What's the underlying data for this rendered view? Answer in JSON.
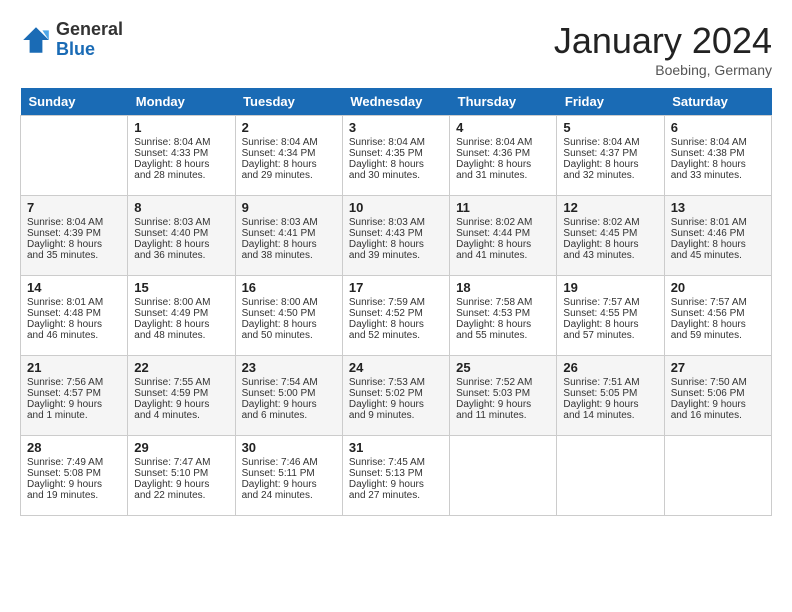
{
  "header": {
    "logo_general": "General",
    "logo_blue": "Blue",
    "month_title": "January 2024",
    "location": "Boebing, Germany"
  },
  "days_of_week": [
    "Sunday",
    "Monday",
    "Tuesday",
    "Wednesday",
    "Thursday",
    "Friday",
    "Saturday"
  ],
  "weeks": [
    [
      {
        "day": "",
        "empty": true
      },
      {
        "day": "1",
        "sunrise": "Sunrise: 8:04 AM",
        "sunset": "Sunset: 4:33 PM",
        "daylight": "Daylight: 8 hours and 28 minutes."
      },
      {
        "day": "2",
        "sunrise": "Sunrise: 8:04 AM",
        "sunset": "Sunset: 4:34 PM",
        "daylight": "Daylight: 8 hours and 29 minutes."
      },
      {
        "day": "3",
        "sunrise": "Sunrise: 8:04 AM",
        "sunset": "Sunset: 4:35 PM",
        "daylight": "Daylight: 8 hours and 30 minutes."
      },
      {
        "day": "4",
        "sunrise": "Sunrise: 8:04 AM",
        "sunset": "Sunset: 4:36 PM",
        "daylight": "Daylight: 8 hours and 31 minutes."
      },
      {
        "day": "5",
        "sunrise": "Sunrise: 8:04 AM",
        "sunset": "Sunset: 4:37 PM",
        "daylight": "Daylight: 8 hours and 32 minutes."
      },
      {
        "day": "6",
        "sunrise": "Sunrise: 8:04 AM",
        "sunset": "Sunset: 4:38 PM",
        "daylight": "Daylight: 8 hours and 33 minutes."
      }
    ],
    [
      {
        "day": "7",
        "sunrise": "Sunrise: 8:04 AM",
        "sunset": "Sunset: 4:39 PM",
        "daylight": "Daylight: 8 hours and 35 minutes."
      },
      {
        "day": "8",
        "sunrise": "Sunrise: 8:03 AM",
        "sunset": "Sunset: 4:40 PM",
        "daylight": "Daylight: 8 hours and 36 minutes."
      },
      {
        "day": "9",
        "sunrise": "Sunrise: 8:03 AM",
        "sunset": "Sunset: 4:41 PM",
        "daylight": "Daylight: 8 hours and 38 minutes."
      },
      {
        "day": "10",
        "sunrise": "Sunrise: 8:03 AM",
        "sunset": "Sunset: 4:43 PM",
        "daylight": "Daylight: 8 hours and 39 minutes."
      },
      {
        "day": "11",
        "sunrise": "Sunrise: 8:02 AM",
        "sunset": "Sunset: 4:44 PM",
        "daylight": "Daylight: 8 hours and 41 minutes."
      },
      {
        "day": "12",
        "sunrise": "Sunrise: 8:02 AM",
        "sunset": "Sunset: 4:45 PM",
        "daylight": "Daylight: 8 hours and 43 minutes."
      },
      {
        "day": "13",
        "sunrise": "Sunrise: 8:01 AM",
        "sunset": "Sunset: 4:46 PM",
        "daylight": "Daylight: 8 hours and 45 minutes."
      }
    ],
    [
      {
        "day": "14",
        "sunrise": "Sunrise: 8:01 AM",
        "sunset": "Sunset: 4:48 PM",
        "daylight": "Daylight: 8 hours and 46 minutes."
      },
      {
        "day": "15",
        "sunrise": "Sunrise: 8:00 AM",
        "sunset": "Sunset: 4:49 PM",
        "daylight": "Daylight: 8 hours and 48 minutes."
      },
      {
        "day": "16",
        "sunrise": "Sunrise: 8:00 AM",
        "sunset": "Sunset: 4:50 PM",
        "daylight": "Daylight: 8 hours and 50 minutes."
      },
      {
        "day": "17",
        "sunrise": "Sunrise: 7:59 AM",
        "sunset": "Sunset: 4:52 PM",
        "daylight": "Daylight: 8 hours and 52 minutes."
      },
      {
        "day": "18",
        "sunrise": "Sunrise: 7:58 AM",
        "sunset": "Sunset: 4:53 PM",
        "daylight": "Daylight: 8 hours and 55 minutes."
      },
      {
        "day": "19",
        "sunrise": "Sunrise: 7:57 AM",
        "sunset": "Sunset: 4:55 PM",
        "daylight": "Daylight: 8 hours and 57 minutes."
      },
      {
        "day": "20",
        "sunrise": "Sunrise: 7:57 AM",
        "sunset": "Sunset: 4:56 PM",
        "daylight": "Daylight: 8 hours and 59 minutes."
      }
    ],
    [
      {
        "day": "21",
        "sunrise": "Sunrise: 7:56 AM",
        "sunset": "Sunset: 4:57 PM",
        "daylight": "Daylight: 9 hours and 1 minute."
      },
      {
        "day": "22",
        "sunrise": "Sunrise: 7:55 AM",
        "sunset": "Sunset: 4:59 PM",
        "daylight": "Daylight: 9 hours and 4 minutes."
      },
      {
        "day": "23",
        "sunrise": "Sunrise: 7:54 AM",
        "sunset": "Sunset: 5:00 PM",
        "daylight": "Daylight: 9 hours and 6 minutes."
      },
      {
        "day": "24",
        "sunrise": "Sunrise: 7:53 AM",
        "sunset": "Sunset: 5:02 PM",
        "daylight": "Daylight: 9 hours and 9 minutes."
      },
      {
        "day": "25",
        "sunrise": "Sunrise: 7:52 AM",
        "sunset": "Sunset: 5:03 PM",
        "daylight": "Daylight: 9 hours and 11 minutes."
      },
      {
        "day": "26",
        "sunrise": "Sunrise: 7:51 AM",
        "sunset": "Sunset: 5:05 PM",
        "daylight": "Daylight: 9 hours and 14 minutes."
      },
      {
        "day": "27",
        "sunrise": "Sunrise: 7:50 AM",
        "sunset": "Sunset: 5:06 PM",
        "daylight": "Daylight: 9 hours and 16 minutes."
      }
    ],
    [
      {
        "day": "28",
        "sunrise": "Sunrise: 7:49 AM",
        "sunset": "Sunset: 5:08 PM",
        "daylight": "Daylight: 9 hours and 19 minutes."
      },
      {
        "day": "29",
        "sunrise": "Sunrise: 7:47 AM",
        "sunset": "Sunset: 5:10 PM",
        "daylight": "Daylight: 9 hours and 22 minutes."
      },
      {
        "day": "30",
        "sunrise": "Sunrise: 7:46 AM",
        "sunset": "Sunset: 5:11 PM",
        "daylight": "Daylight: 9 hours and 24 minutes."
      },
      {
        "day": "31",
        "sunrise": "Sunrise: 7:45 AM",
        "sunset": "Sunset: 5:13 PM",
        "daylight": "Daylight: 9 hours and 27 minutes."
      },
      {
        "day": "",
        "empty": true
      },
      {
        "day": "",
        "empty": true
      },
      {
        "day": "",
        "empty": true
      }
    ]
  ]
}
